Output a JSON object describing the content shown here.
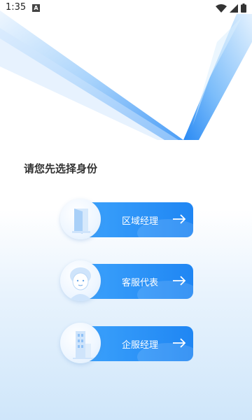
{
  "status_bar": {
    "time": "1:35",
    "notification_glyph": "A"
  },
  "prompt": "请您先选择身份",
  "roles": [
    {
      "label": "区域经理",
      "icon": "door-icon"
    },
    {
      "label": "客服代表",
      "icon": "agent-avatar-icon"
    },
    {
      "label": "企服经理",
      "icon": "building-icon"
    }
  ],
  "colors": {
    "accent": "#1f86f3",
    "accent_light": "#3aa0fb",
    "background_tint": "#cfe6fa"
  }
}
